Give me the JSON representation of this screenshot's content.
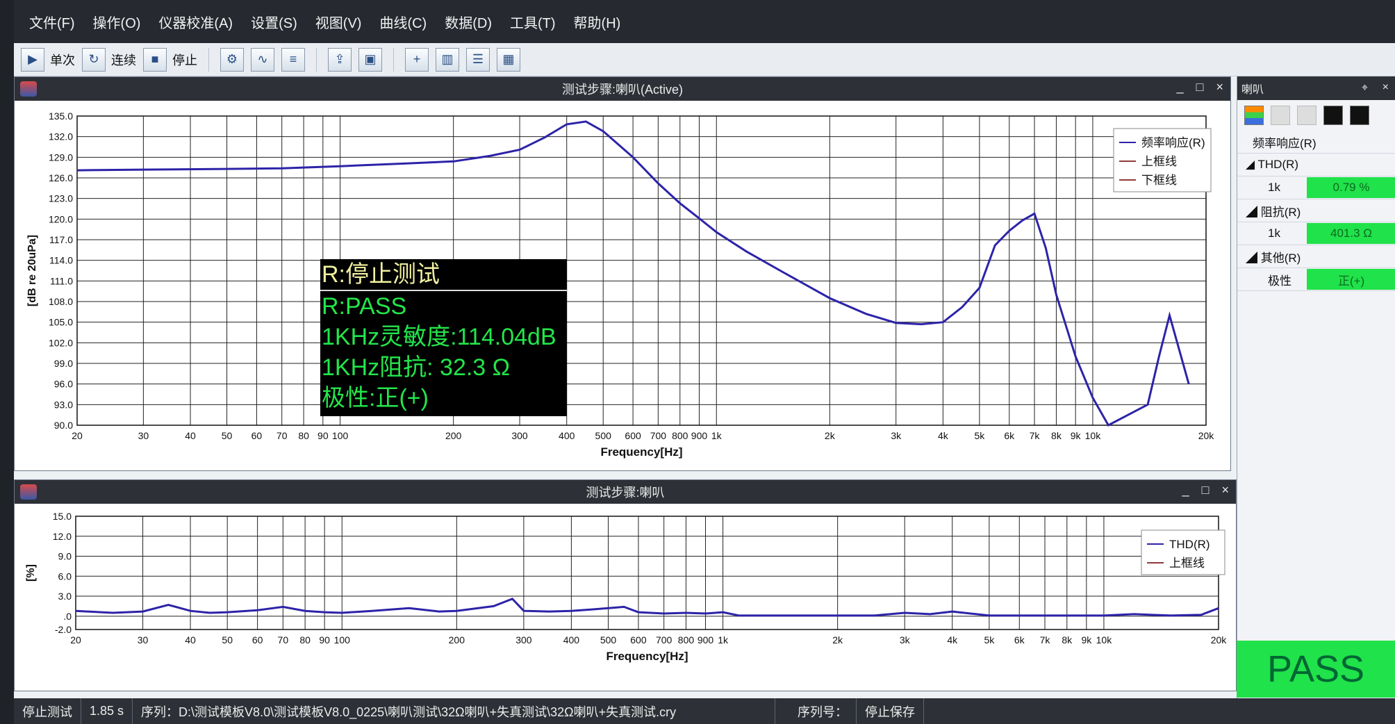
{
  "menubar": {
    "items": [
      "文件(F)",
      "操作(O)",
      "仪器校准(A)",
      "设置(S)",
      "视图(V)",
      "曲线(C)",
      "数据(D)",
      "工具(T)",
      "帮助(H)"
    ]
  },
  "toolbar": {
    "single": "单次",
    "continuous": "连续",
    "stop": "停止"
  },
  "window_top": {
    "title": "测试步骤:喇叭(Active)"
  },
  "window_bottom": {
    "title": "测试步骤:喇叭"
  },
  "overlay": {
    "line1": "R:停止测试",
    "line2": "R:PASS",
    "line3": "1KHz灵敏度:114.04dB",
    "line4": "1KHz阻抗: 32.3 Ω",
    "line5": "极性:正(+)"
  },
  "chart_data": [
    {
      "type": "line",
      "ylabel": "[dB re 20uPa]",
      "xlabel": "Frequency[Hz]",
      "x_scale": "log",
      "xlim": [
        20,
        20000
      ],
      "ylim": [
        90,
        135
      ],
      "x_ticks": [
        [
          20,
          "20"
        ],
        [
          30,
          "30"
        ],
        [
          40,
          "40"
        ],
        [
          50,
          "50"
        ],
        [
          60,
          "60"
        ],
        [
          70,
          "70"
        ],
        [
          80,
          "80"
        ],
        [
          90,
          "90"
        ],
        [
          100,
          "100"
        ],
        [
          200,
          "200"
        ],
        [
          300,
          "300"
        ],
        [
          400,
          "400"
        ],
        [
          500,
          "500"
        ],
        [
          600,
          "600"
        ],
        [
          700,
          "700"
        ],
        [
          800,
          "800"
        ],
        [
          900,
          "900"
        ],
        [
          1000,
          "1k"
        ],
        [
          2000,
          "2k"
        ],
        [
          3000,
          "3k"
        ],
        [
          4000,
          "4k"
        ],
        [
          5000,
          "5k"
        ],
        [
          6000,
          "6k"
        ],
        [
          7000,
          "7k"
        ],
        [
          8000,
          "8k"
        ],
        [
          9000,
          "9k"
        ],
        [
          10000,
          "10k"
        ],
        [
          20000,
          "20k"
        ]
      ],
      "y_ticks": [
        "135.0",
        "132.0",
        "129.0",
        "126.0",
        "123.0",
        "120.0",
        "117.0",
        "114.0",
        "111.0",
        "108.0",
        "105.0",
        "102.0",
        "99.0",
        "96.0",
        "93.0",
        "90.0"
      ],
      "legend": [
        "频率响应(R)",
        "上框线",
        "下框线"
      ],
      "series": [
        {
          "name": "频率响应(R)",
          "x": [
            20,
            30,
            50,
            70,
            100,
            150,
            200,
            250,
            300,
            350,
            400,
            450,
            500,
            600,
            700,
            800,
            900,
            1000,
            1200,
            1500,
            2000,
            2500,
            3000,
            3500,
            4000,
            4500,
            5000,
            5500,
            6000,
            6500,
            7000,
            7500,
            8000,
            9000,
            10000,
            11000,
            14000,
            15000,
            16000,
            18000
          ],
          "y": [
            127.1,
            127.2,
            127.3,
            127.4,
            127.7,
            128.1,
            128.4,
            129.2,
            130.1,
            131.9,
            133.8,
            134.2,
            132.8,
            129,
            125.2,
            122.3,
            120.1,
            118.1,
            115.3,
            112.3,
            108.5,
            106.2,
            104.9,
            104.7,
            105,
            107.2,
            110,
            116.2,
            118.3,
            119.8,
            120.8,
            115.8,
            109,
            100,
            94,
            88,
            93,
            100,
            106,
            96
          ]
        }
      ]
    },
    {
      "type": "line",
      "ylabel": "[%]",
      "xlabel": "Frequency[Hz]",
      "x_scale": "log",
      "xlim": [
        20,
        20000
      ],
      "ylim": [
        -2,
        15
      ],
      "x_ticks": [
        [
          20,
          "20"
        ],
        [
          30,
          "30"
        ],
        [
          40,
          "40"
        ],
        [
          50,
          "50"
        ],
        [
          60,
          "60"
        ],
        [
          70,
          "70"
        ],
        [
          80,
          "80"
        ],
        [
          90,
          "90"
        ],
        [
          100,
          "100"
        ],
        [
          200,
          "200"
        ],
        [
          300,
          "300"
        ],
        [
          400,
          "400"
        ],
        [
          500,
          "500"
        ],
        [
          600,
          "600"
        ],
        [
          700,
          "700"
        ],
        [
          800,
          "800"
        ],
        [
          900,
          "900"
        ],
        [
          1000,
          "1k"
        ],
        [
          2000,
          "2k"
        ],
        [
          3000,
          "3k"
        ],
        [
          4000,
          "4k"
        ],
        [
          5000,
          "5k"
        ],
        [
          6000,
          "6k"
        ],
        [
          7000,
          "7k"
        ],
        [
          8000,
          "8k"
        ],
        [
          9000,
          "9k"
        ],
        [
          10000,
          "10k"
        ],
        [
          20000,
          "20k"
        ]
      ],
      "y_ticks": [
        "15.0",
        "12.0",
        "9.0",
        "6.0",
        "3.0",
        ".0",
        "-2.0"
      ],
      "legend": [
        "THD(R)",
        "上框线"
      ],
      "series": [
        {
          "name": "THD(R)",
          "x": [
            20,
            25,
            30,
            35,
            40,
            45,
            50,
            60,
            70,
            80,
            90,
            100,
            120,
            150,
            180,
            200,
            250,
            280,
            300,
            350,
            400,
            450,
            500,
            550,
            600,
            700,
            800,
            900,
            1000,
            1100,
            1500,
            2000,
            2500,
            3000,
            3500,
            4000,
            5000,
            6000,
            7000,
            8000,
            9000,
            10000,
            12000,
            15000,
            18000,
            20000
          ],
          "y": [
            0.8,
            0.5,
            0.7,
            1.7,
            0.8,
            0.5,
            0.6,
            0.9,
            1.4,
            0.8,
            0.6,
            0.5,
            0.8,
            1.2,
            0.7,
            0.8,
            1.5,
            2.6,
            0.8,
            0.7,
            0.8,
            1.0,
            1.2,
            1.4,
            0.6,
            0.4,
            0.5,
            0.4,
            0.6,
            0.1,
            0.1,
            0.1,
            0.1,
            0.5,
            0.3,
            0.7,
            0.1,
            0.1,
            0.1,
            0.1,
            0.1,
            0.1,
            0.3,
            0.1,
            0.2,
            1.2
          ]
        }
      ]
    }
  ],
  "side": {
    "title": "喇叭",
    "items": [
      {
        "group": "频率响应(R)"
      },
      {
        "group": "THD(R)",
        "name": "1k",
        "value": "0.79 %"
      },
      {
        "group": "阻抗(R)",
        "name": "1k",
        "value": "401.3 Ω"
      },
      {
        "group": "其他(R)",
        "name": "极性",
        "value": "正(+)"
      }
    ]
  },
  "result": "PASS",
  "status": {
    "state": "停止测试",
    "time": "1.85 s",
    "path": "序列：D:\\测试模板V8.0\\测试模板V8.0_0225\\喇叭测试\\32Ω喇叭+失真测试\\32Ω喇叭+失真测试.cry",
    "serial": "序列号：",
    "save": "停止保存"
  }
}
